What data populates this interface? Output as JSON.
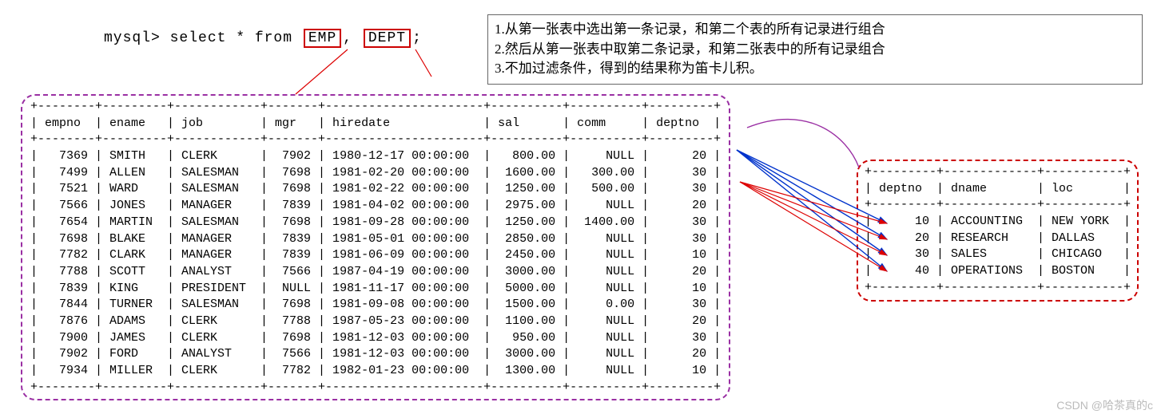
{
  "sql": {
    "prompt": "mysql>",
    "stmt_pre": " select * from ",
    "kw1": "EMP",
    "mid": ", ",
    "kw2": "DEPT",
    "stmt_post": ";"
  },
  "explain": {
    "line1": "1.从第一张表中选出第一条记录，和第二个表的所有记录进行组合",
    "line2": "2.然后从第一张表中取第二条记录，和第二张表中的所有记录组合",
    "line3": "3.不加过滤条件，得到的结果称为笛卡儿积。"
  },
  "emp_table": {
    "headers": [
      "empno",
      "ename",
      "job",
      "mgr",
      "hiredate",
      "sal",
      "comm",
      "deptno"
    ],
    "rows": [
      [
        "7369",
        "SMITH",
        "CLERK",
        "7902",
        "1980-12-17 00:00:00",
        "800.00",
        "NULL",
        "20"
      ],
      [
        "7499",
        "ALLEN",
        "SALESMAN",
        "7698",
        "1981-02-20 00:00:00",
        "1600.00",
        "300.00",
        "30"
      ],
      [
        "7521",
        "WARD",
        "SALESMAN",
        "7698",
        "1981-02-22 00:00:00",
        "1250.00",
        "500.00",
        "30"
      ],
      [
        "7566",
        "JONES",
        "MANAGER",
        "7839",
        "1981-04-02 00:00:00",
        "2975.00",
        "NULL",
        "20"
      ],
      [
        "7654",
        "MARTIN",
        "SALESMAN",
        "7698",
        "1981-09-28 00:00:00",
        "1250.00",
        "1400.00",
        "30"
      ],
      [
        "7698",
        "BLAKE",
        "MANAGER",
        "7839",
        "1981-05-01 00:00:00",
        "2850.00",
        "NULL",
        "30"
      ],
      [
        "7782",
        "CLARK",
        "MANAGER",
        "7839",
        "1981-06-09 00:00:00",
        "2450.00",
        "NULL",
        "10"
      ],
      [
        "7788",
        "SCOTT",
        "ANALYST",
        "7566",
        "1987-04-19 00:00:00",
        "3000.00",
        "NULL",
        "20"
      ],
      [
        "7839",
        "KING",
        "PRESIDENT",
        "NULL",
        "1981-11-17 00:00:00",
        "5000.00",
        "NULL",
        "10"
      ],
      [
        "7844",
        "TURNER",
        "SALESMAN",
        "7698",
        "1981-09-08 00:00:00",
        "1500.00",
        "0.00",
        "30"
      ],
      [
        "7876",
        "ADAMS",
        "CLERK",
        "7788",
        "1987-05-23 00:00:00",
        "1100.00",
        "NULL",
        "20"
      ],
      [
        "7900",
        "JAMES",
        "CLERK",
        "7698",
        "1981-12-03 00:00:00",
        "950.00",
        "NULL",
        "30"
      ],
      [
        "7902",
        "FORD",
        "ANALYST",
        "7566",
        "1981-12-03 00:00:00",
        "3000.00",
        "NULL",
        "20"
      ],
      [
        "7934",
        "MILLER",
        "CLERK",
        "7782",
        "1982-01-23 00:00:00",
        "1300.00",
        "NULL",
        "10"
      ]
    ]
  },
  "dept_table": {
    "headers": [
      "deptno",
      "dname",
      "loc"
    ],
    "rows": [
      [
        "10",
        "ACCOUNTING",
        "NEW YORK"
      ],
      [
        "20",
        "RESEARCH",
        "DALLAS"
      ],
      [
        "30",
        "SALES",
        "CHICAGO"
      ],
      [
        "40",
        "OPERATIONS",
        "BOSTON"
      ]
    ]
  },
  "watermark": "CSDN @哈茶真的c"
}
